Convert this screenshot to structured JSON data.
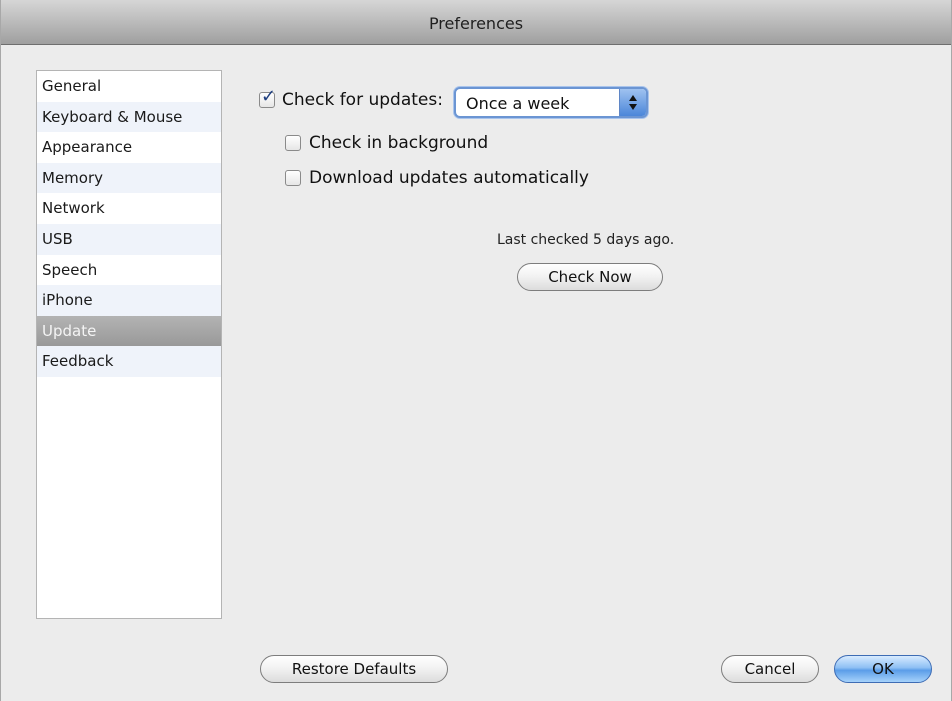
{
  "window": {
    "title": "Preferences"
  },
  "sidebar": {
    "items": [
      {
        "label": "General"
      },
      {
        "label": "Keyboard & Mouse"
      },
      {
        "label": "Appearance"
      },
      {
        "label": "Memory"
      },
      {
        "label": "Network"
      },
      {
        "label": "USB"
      },
      {
        "label": "Speech"
      },
      {
        "label": "iPhone"
      },
      {
        "label": "Update",
        "selected": true
      },
      {
        "label": "Feedback"
      }
    ]
  },
  "update": {
    "check_for_updates": {
      "label": "Check for updates:",
      "checked": true
    },
    "frequency": {
      "value": "Once a week"
    },
    "check_in_background": {
      "label": "Check in background",
      "checked": false
    },
    "download_automatically": {
      "label": "Download updates automatically",
      "checked": false
    },
    "status": "Last checked 5 days ago.",
    "check_now_label": "Check Now"
  },
  "footer": {
    "restore_defaults_label": "Restore Defaults",
    "cancel_label": "Cancel",
    "ok_label": "OK"
  },
  "colors": {
    "selection": "#a7a7a7",
    "accent_blue": "#5b9de8",
    "window_bg": "#ececec"
  }
}
